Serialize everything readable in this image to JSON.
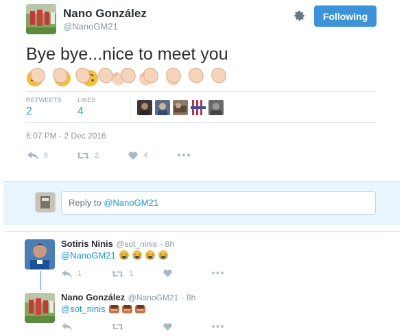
{
  "tweet": {
    "author_name": "Nano González",
    "author_handle": "@NanoGM21",
    "follow_label": "Following",
    "text": "Bye bye...nice to meet you",
    "stats": {
      "retweets_label": "RETWEETS",
      "retweets": "2",
      "likes_label": "LIKES",
      "likes": "4"
    },
    "timestamp": "6:07 PM - 2 Dec 2016",
    "actions": {
      "reply_count": "6",
      "retweet_count": "2",
      "like_count": "4"
    }
  },
  "reply_box": {
    "prefix": "Reply to ",
    "mention": "@NanoGM21"
  },
  "replies": [
    {
      "name": "Sotiris Ninis",
      "handle": "@sot_ninis",
      "time": "· 8h",
      "mention": "@NanoGM21",
      "reply_count": "1",
      "retweet_count": "1",
      "like_count": ""
    },
    {
      "name": "Nano González",
      "handle": "@NanoGM21",
      "time": "· 8h",
      "mention": "@sot_ninis",
      "reply_count": "",
      "retweet_count": "",
      "like_count": ""
    }
  ],
  "colors": {
    "accent": "#3b94d9",
    "link": "#1b95e0",
    "muted": "#8899a6",
    "icon": "#aab8c2"
  }
}
